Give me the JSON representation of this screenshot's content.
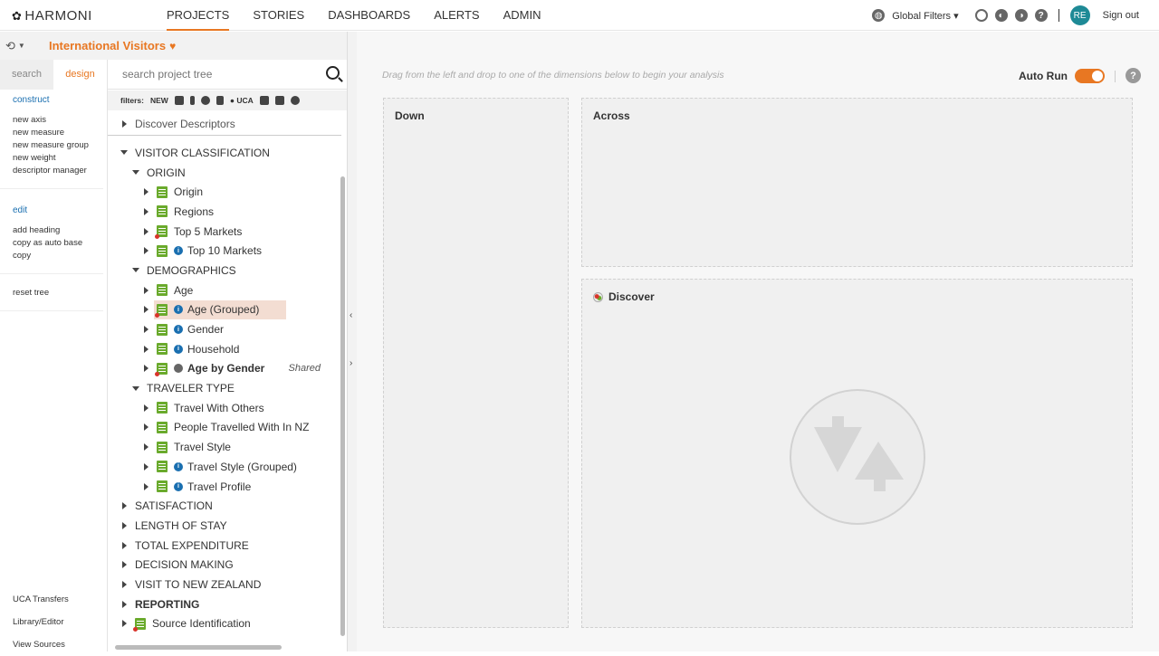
{
  "brand": "HARMONI",
  "nav": [
    "PROJECTS",
    "STORIES",
    "DASHBOARDS",
    "ALERTS",
    "ADMIN"
  ],
  "global_filters": "Global Filters",
  "avatar": "RE",
  "signout": "Sign out",
  "project_title": "International Visitors",
  "tabs": [
    "search",
    "design"
  ],
  "construct": {
    "head": "construct",
    "items": [
      "new axis",
      "new measure",
      "new measure group",
      "new weight",
      "descriptor manager"
    ]
  },
  "edit": {
    "head": "edit",
    "items": [
      "add heading",
      "copy as auto base",
      "copy"
    ]
  },
  "reset": "reset tree",
  "bottom_links": [
    "UCA Transfers",
    "Library/Editor",
    "View Sources"
  ],
  "tree_search_placeholder": "search project tree",
  "filters_label": "filters:",
  "filters_new": "NEW",
  "filters_uca": "UCA",
  "discover_descriptors": "Discover Descriptors",
  "tree": {
    "visitor_classification": "VISITOR CLASSIFICATION",
    "origin": "ORIGIN",
    "origin_items": [
      "Origin",
      "Regions",
      "Top 5 Markets",
      "Top 10 Markets"
    ],
    "demographics": "DEMOGRAPHICS",
    "demo_items": [
      "Age",
      "Age (Grouped)",
      "Gender",
      "Household",
      "Age by Gender"
    ],
    "shared": "Shared",
    "traveler_type": "TRAVELER TYPE",
    "traveler_items": [
      "Travel With Others",
      "People Travelled With In NZ",
      "Travel Style",
      "Travel Style (Grouped)",
      "Travel Profile"
    ],
    "top_sections": [
      "SATISFACTION",
      "LENGTH OF STAY",
      "TOTAL EXPENDITURE",
      "DECISION MAKING",
      "VISIT TO NEW ZEALAND",
      "REPORTING",
      "Source Identification"
    ]
  },
  "hint": "Drag from the left and drop to one of the dimensions below to begin your analysis",
  "auto_run": "Auto Run",
  "zones": {
    "down": "Down",
    "across": "Across",
    "discover": "Discover"
  },
  "colors": {
    "accent": "#e87722",
    "link": "#1a6fb0",
    "doc_icon": "#6aaa2c",
    "avatar": "#1e8a96"
  }
}
